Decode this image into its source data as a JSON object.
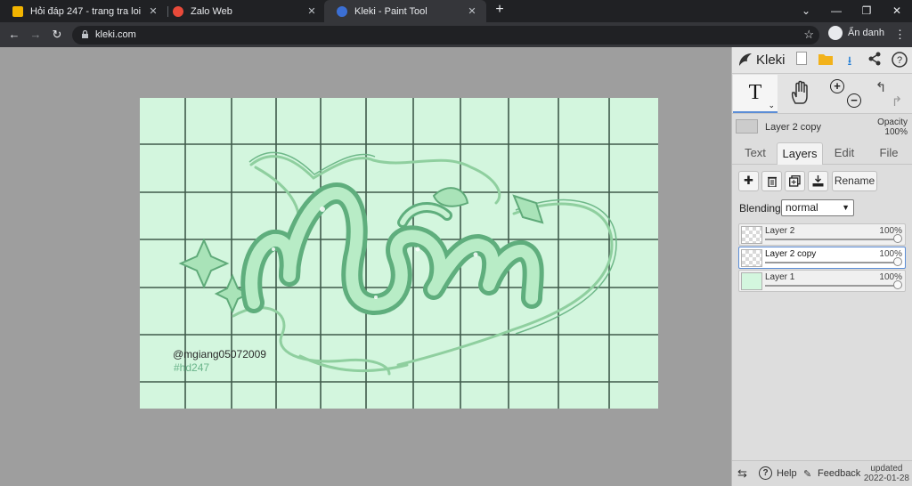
{
  "browser": {
    "tabs": [
      {
        "title": "Hỏi đáp 247 - trang tra loi",
        "favicon_color": "#f2b400"
      },
      {
        "title": "Zalo Web",
        "favicon_color": "#e84a3a"
      },
      {
        "title": "Kleki - Paint Tool",
        "favicon_color": "#3b6fd4",
        "active": true
      }
    ],
    "url": "kleki.com",
    "profile_label": "Ẩn danh"
  },
  "canvas": {
    "background": "#d3f6de",
    "grid_color": "#3f5a4a",
    "signature_line1": "@mgiang05072009",
    "signature_line2": "#hd247"
  },
  "app": {
    "name": "Kleki",
    "current_layer_name": "Layer 2 copy",
    "opacity_label": "Opacity",
    "opacity_value": "100%",
    "tabs": [
      "Text",
      "Layers",
      "Edit",
      "File"
    ],
    "active_tab": "Layers",
    "rename_label": "Rename",
    "blending_label": "Blending",
    "blending_value": "normal",
    "layers": [
      {
        "name": "Layer 2",
        "opacity": "100%",
        "selected": false
      },
      {
        "name": "Layer 2 copy",
        "opacity": "100%",
        "selected": true
      },
      {
        "name": "Layer 1",
        "opacity": "100%",
        "selected": false
      }
    ],
    "footer": {
      "help_label": "Help",
      "feedback_label": "Feedback",
      "updated_label": "updated",
      "updated_date": "2022-01-28"
    }
  }
}
